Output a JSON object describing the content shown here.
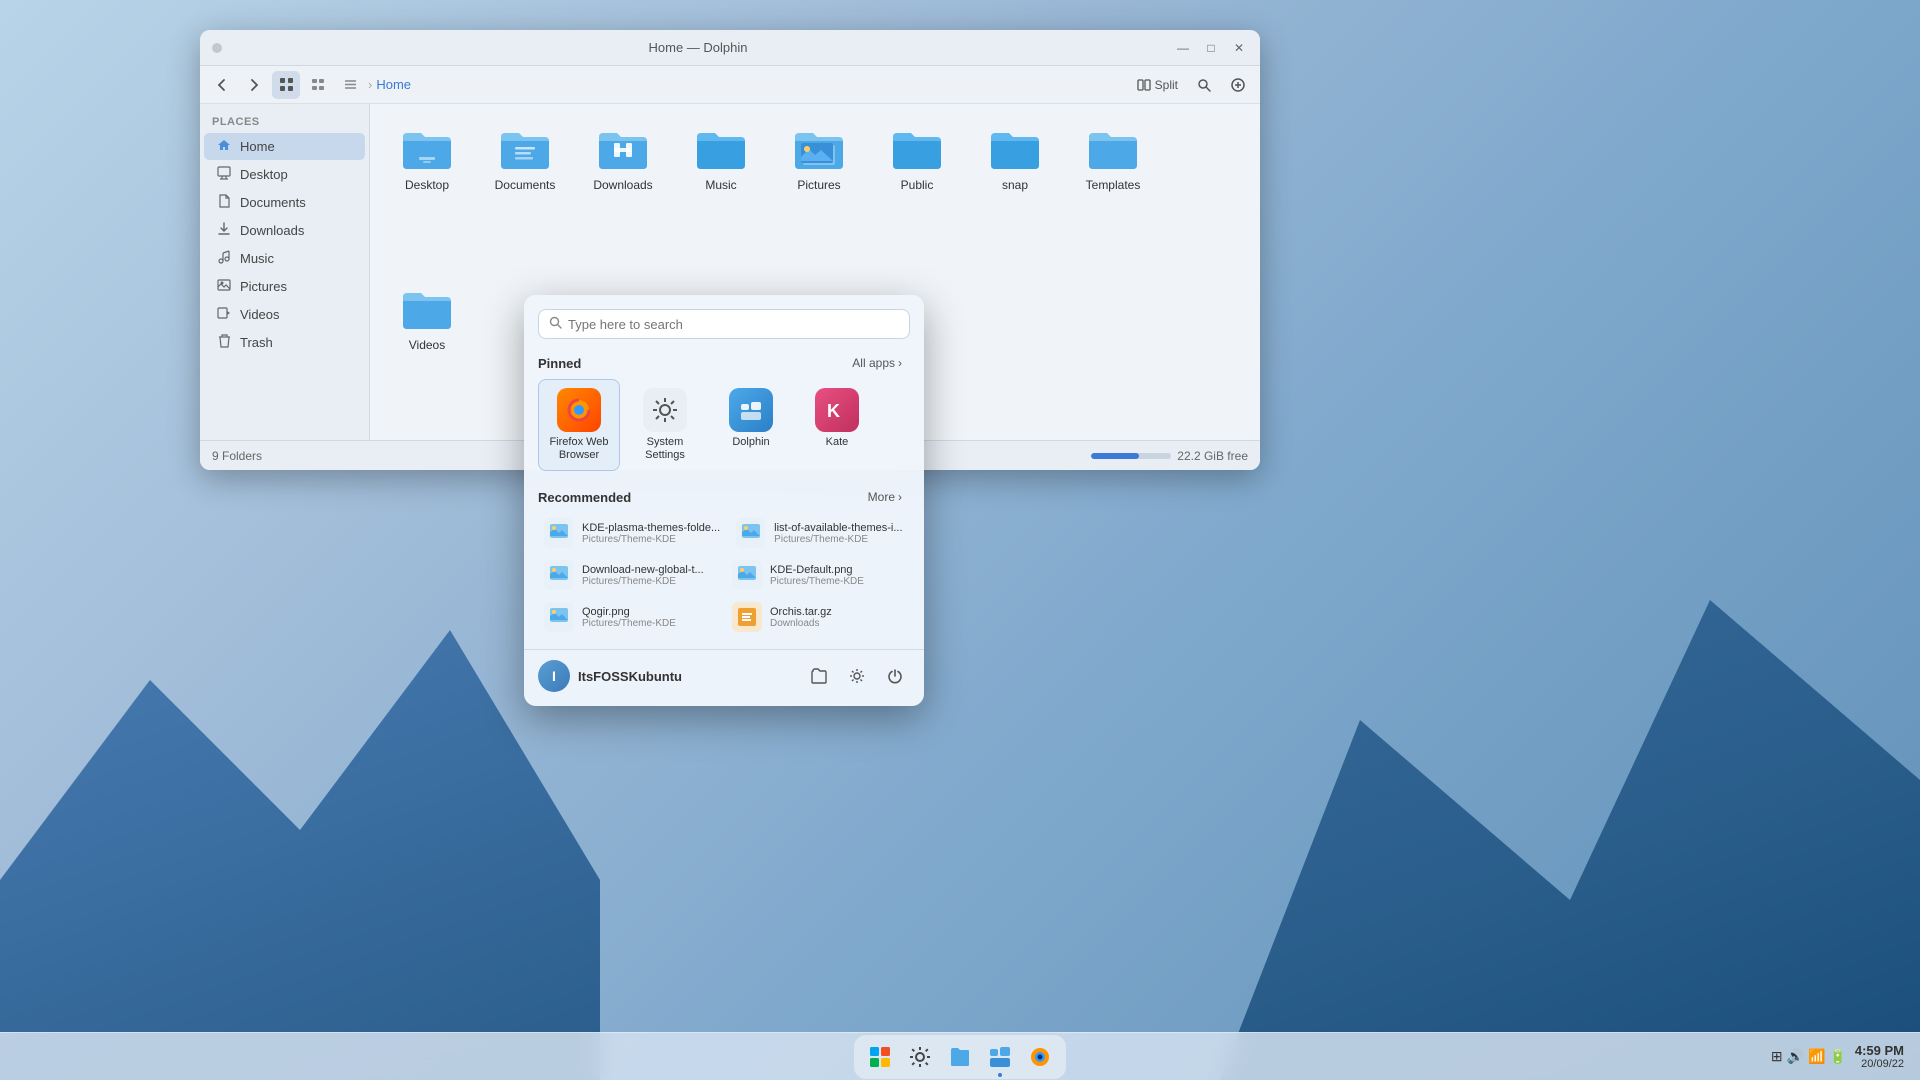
{
  "window": {
    "title": "Home — Dolphin",
    "icon": "🐬",
    "dot": "•"
  },
  "toolbar": {
    "back_label": "←",
    "forward_label": "→",
    "view_grid_label": "⊞",
    "view_compact_label": "⊟",
    "view_list_label": "☰",
    "breadcrumb_sep": "›",
    "breadcrumb_home": "Home",
    "split_label": "Split",
    "search_icon": "🔍"
  },
  "window_controls": {
    "minimize": "—",
    "maximize": "□",
    "close": "✕"
  },
  "sidebar": {
    "section_title": "Places",
    "items": [
      {
        "label": "Home",
        "icon": "🏠",
        "active": true
      },
      {
        "label": "Desktop",
        "icon": "🖥"
      },
      {
        "label": "Documents",
        "icon": "📁"
      },
      {
        "label": "Downloads",
        "icon": "⬇"
      },
      {
        "label": "Music",
        "icon": "🎵"
      },
      {
        "label": "Pictures",
        "icon": "🖼"
      },
      {
        "label": "Videos",
        "icon": "🎬"
      },
      {
        "label": "Trash",
        "icon": "🗑"
      }
    ]
  },
  "folders": [
    {
      "label": "Desktop"
    },
    {
      "label": "Documents"
    },
    {
      "label": "Downloads"
    },
    {
      "label": "Music"
    },
    {
      "label": "Pictures"
    },
    {
      "label": "Public"
    },
    {
      "label": "snap"
    },
    {
      "label": "Templates"
    },
    {
      "label": "Videos"
    }
  ],
  "status_bar": {
    "folder_count": "9 Folders",
    "storage_text": "22.2 GiB free"
  },
  "launcher": {
    "search_placeholder": "Type here to search",
    "pinned_section": "Pinned",
    "all_apps_label": "All apps",
    "all_apps_arrow": "›",
    "pinned_items": [
      {
        "label": "Firefox Web Browser",
        "icon": "firefox"
      },
      {
        "label": "System Settings",
        "icon": "settings"
      },
      {
        "label": "Dolphin",
        "icon": "dolphin"
      },
      {
        "label": "Kate",
        "icon": "kate"
      }
    ],
    "recommended_section": "Recommended",
    "more_label": "More",
    "more_arrow": "›",
    "recommended_items": [
      {
        "name": "KDE-plasma-themes-folde...",
        "path": "Pictures/Theme-KDE",
        "icon": "image"
      },
      {
        "name": "list-of-available-themes-i...",
        "path": "Pictures/Theme-KDE",
        "icon": "image"
      },
      {
        "name": "Download-new-global-t...",
        "path": "Pictures/Theme-KDE",
        "icon": "image"
      },
      {
        "name": "KDE-Default.png",
        "path": "Pictures/Theme-KDE",
        "icon": "image"
      },
      {
        "name": "Qogir.png",
        "path": "Pictures/Theme-KDE",
        "icon": "image"
      },
      {
        "name": "Orchis.tar.gz",
        "path": "Downloads",
        "icon": "archive"
      }
    ],
    "user_name": "ItsFOSSKubuntu",
    "footer_buttons": [
      {
        "icon": "📁",
        "label": "files"
      },
      {
        "icon": "⚙",
        "label": "settings"
      },
      {
        "icon": "⏻",
        "label": "power"
      }
    ]
  },
  "taskbar": {
    "icons": [
      {
        "icon": "⊞",
        "label": "start"
      },
      {
        "icon": "⚙",
        "label": "settings"
      },
      {
        "icon": "📁",
        "label": "files"
      },
      {
        "icon": "🐬",
        "label": "dolphin"
      },
      {
        "icon": "🦊",
        "label": "firefox"
      }
    ],
    "time": "4:59 PM",
    "date": "20/09/22"
  }
}
